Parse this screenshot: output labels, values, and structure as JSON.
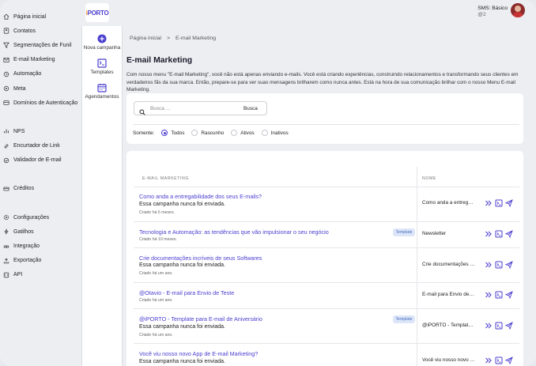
{
  "brand": {
    "logo_prefix": "i",
    "logo_text": "PORTO"
  },
  "user": {
    "plan": "SMS: Básico",
    "plan_sub": "@2"
  },
  "sidebar": {
    "group1": [
      {
        "label": "Página inicial",
        "icon": "home-icon"
      },
      {
        "label": "Contatos",
        "icon": "contacts-icon"
      },
      {
        "label": "Segmentações de Funil",
        "icon": "funnel-icon"
      },
      {
        "label": "E-mail Marketing",
        "icon": "mail-icon"
      },
      {
        "label": "Automação",
        "icon": "automation-icon"
      },
      {
        "label": "Meta",
        "icon": "target-icon"
      },
      {
        "label": "Domínios de Autenticação",
        "icon": "domain-icon"
      }
    ],
    "group2": [
      {
        "label": "NPS",
        "icon": "nps-icon"
      },
      {
        "label": "Encurtador de Link",
        "icon": "link-icon"
      },
      {
        "label": "Validador de E-mail",
        "icon": "validator-icon"
      }
    ],
    "group3": [
      {
        "label": "Créditos",
        "icon": "credits-icon"
      }
    ],
    "group4": [
      {
        "label": "Configurações",
        "icon": "gear-icon"
      },
      {
        "label": "Gatilhos",
        "icon": "trigger-icon"
      },
      {
        "label": "Integração",
        "icon": "integration-icon"
      },
      {
        "label": "Exportação",
        "icon": "export-icon"
      },
      {
        "label": "API",
        "icon": "api-icon"
      }
    ]
  },
  "subbar": {
    "items": [
      {
        "label": "Nova campanha",
        "icon": "plus-circle-icon"
      },
      {
        "label": "Templates",
        "icon": "template-icon"
      },
      {
        "label": "Agendamentos",
        "icon": "calendar-icon"
      }
    ]
  },
  "breadcrumb": {
    "home": "Página inicial",
    "separator": ">",
    "current": "E-mail Marketing"
  },
  "page": {
    "title": "E-mail Marketing",
    "description": "Com nosso menu \"E-mail Marketing\", você não está apenas enviando e-mails. Você está criando experiências, construindo relacionamentos e transformando seus clientes em verdadeiros fãs da sua marca. Então, prepare-se para ver suas mensagens brilharem como nunca antes. Está na hora de sua comunicação brilhar com o nosso Menu E-mail Marketing."
  },
  "search": {
    "placeholder": "Busca ...",
    "button": "Busca"
  },
  "filters": {
    "label": "Somente:",
    "options": [
      "Todos",
      "Rascunho",
      "Ativos",
      "Inativos"
    ],
    "selected": "Todos"
  },
  "table": {
    "columns": [
      "E-mail Marketing",
      "Nome"
    ],
    "rows": [
      {
        "title": "Como anda a entregabilidade dos seus E-mails?",
        "status": "Essa campanha nunca foi enviada.",
        "meta": "Criado há 6 meses.",
        "badge": "",
        "name": "Como anda a entrega..."
      },
      {
        "title": "Tecnologia e Automação: as tendências que vão impulsionar o seu negócio",
        "status": "",
        "meta": "Criado há 10 meses.",
        "badge": "Template",
        "name": "Newsletter"
      },
      {
        "title": "Crie documentações incríveis de seus Softwares",
        "status": "Essa campanha nunca foi enviada.",
        "meta": "Criado há um ano.",
        "badge": "",
        "name": "Crie documentações i..."
      },
      {
        "title": "@Otavio - E-mail para Envio de Teste",
        "status": "",
        "meta": "Criado há um ano.",
        "badge": "",
        "name": "E-mail para Envio de T..."
      },
      {
        "title": "@iPORTO - Template para E-mail de Aniversário",
        "status": "Essa campanha nunca foi enviada.",
        "meta": "Criado há um ano.",
        "badge": "Template",
        "name": "@iPORTO - Template ..."
      },
      {
        "title": "Você viu nosso novo App de E-mail Marketing?",
        "status": "Essa campanha nunca foi enviada.",
        "meta": "",
        "badge": "",
        "name": "Você viu nosso novo A..."
      }
    ]
  },
  "colors": {
    "accent": "#4b3fcf",
    "logo_accent": "#f28a1b",
    "badge_bg": "#dde6f8"
  }
}
